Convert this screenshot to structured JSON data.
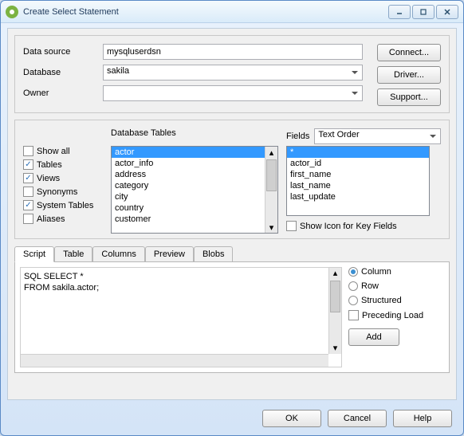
{
  "title": "Create Select Statement",
  "connection": {
    "data_source_label": "Data source",
    "data_source_value": "mysqluserdsn",
    "database_label": "Database",
    "database_value": "sakila",
    "owner_label": "Owner",
    "owner_value": ""
  },
  "buttons": {
    "connect": "Connect...",
    "driver": "Driver...",
    "support": "Support..."
  },
  "options": {
    "show_all": "Show all",
    "tables": "Tables",
    "views": "Views",
    "synonyms": "Synonyms",
    "system_tables": "System Tables",
    "aliases": "Aliases",
    "show_all_chk": false,
    "tables_chk": true,
    "views_chk": true,
    "synonyms_chk": false,
    "system_tables_chk": true,
    "aliases_chk": false
  },
  "tables": {
    "header": "Database Tables",
    "items": [
      "actor",
      "actor_info",
      "address",
      "category",
      "city",
      "country",
      "customer"
    ],
    "selected": "actor"
  },
  "fields": {
    "header": "Fields",
    "order_value": "Text Order",
    "items": [
      "*",
      "actor_id",
      "first_name",
      "last_name",
      "last_update"
    ],
    "selected": "*",
    "show_icon_label": "Show Icon for Key Fields",
    "show_icon_chk": false
  },
  "tabs": {
    "items": [
      "Script",
      "Table",
      "Columns",
      "Preview",
      "Blobs"
    ],
    "active": "Script"
  },
  "sql": {
    "kw1": "SQL SELECT",
    "rest1": " *",
    "kw2": "FROM",
    "rest2": " sakila.actor;"
  },
  "result": {
    "column": "Column",
    "row": "Row",
    "structured": "Structured",
    "preceding_load": "Preceding Load",
    "preceding_chk": false,
    "add": "Add"
  },
  "footer": {
    "ok": "OK",
    "cancel": "Cancel",
    "help": "Help"
  }
}
